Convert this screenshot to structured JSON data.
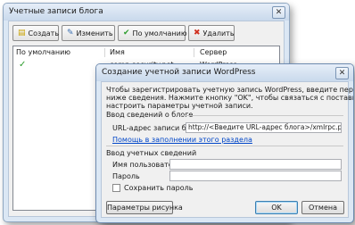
{
  "back_window": {
    "title": "Учетные записи блога",
    "close_glyph": "✕",
    "toolbar": [
      {
        "label": "Создать",
        "icon": "new-document-icon",
        "glyph": "📄",
        "color": "#c9a200"
      },
      {
        "label": "Изменить",
        "icon": "edit-icon",
        "glyph": "✎",
        "color": "#3a6fb0"
      },
      {
        "label": "По умолчанию",
        "icon": "checkmark-icon",
        "glyph": "✔",
        "color": "#2e9d2e"
      },
      {
        "label": "Удалить",
        "icon": "delete-icon",
        "glyph": "✖",
        "color": "#d03020"
      }
    ],
    "table": {
      "columns": [
        "По умолчанию",
        "Имя",
        "Сервер"
      ],
      "rows": [
        {
          "default_mark": "✓",
          "name": "comp-security.net",
          "server": "WordPress"
        }
      ]
    }
  },
  "dialog": {
    "title": "Создание учетной записи WordPress",
    "close_glyph": "✕",
    "intro": [
      "Чтобы зарегистрировать учетную запись WordPress, введите перечисленные",
      "ниже сведения. Нажмите кнопку \"OK\", чтобы связаться с поставщиком и",
      "настроить параметры учетной записи."
    ],
    "blog_section": {
      "heading": "Ввод сведений о блоге",
      "url_label": "URL-адрес записи блога",
      "url_value": "http://<Введите URL-адрес блога>/xmlrpc.php",
      "help_link": "Помощь в заполнении этого раздела"
    },
    "account_section": {
      "heading": "Ввод учетных сведений",
      "username_label": "Имя пользователя",
      "username_value": "",
      "password_label": "Пароль",
      "password_value": "",
      "remember_label": "Сохранить пароль",
      "remember_checked": false
    },
    "buttons": {
      "picture_options": "Параметры рисунка",
      "ok": "OK",
      "cancel": "Отмена"
    }
  }
}
